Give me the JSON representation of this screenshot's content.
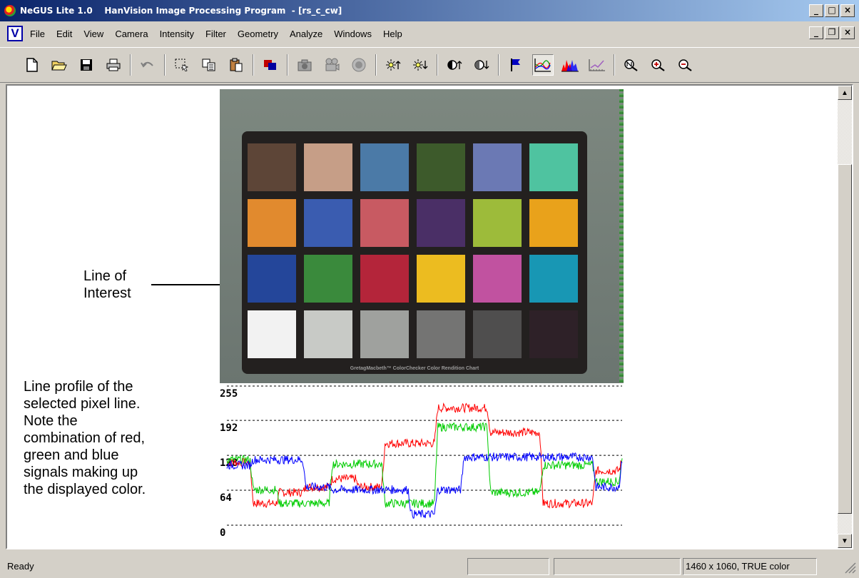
{
  "window": {
    "title": "NeGUS Lite 1.0    HanVision Image Processing Program  - [rs_c_cw]",
    "minimize_glyph": "_",
    "maximize_glyph": "□",
    "close_glyph": "×",
    "restore_glyph": "❐"
  },
  "menu": {
    "doc_icon_letter": "V",
    "items": [
      "File",
      "Edit",
      "View",
      "Camera",
      "Intensity",
      "Filter",
      "Geometry",
      "Analyze",
      "Windows",
      "Help"
    ]
  },
  "toolbar": {
    "buttons": [
      {
        "icon": "new-document-icon"
      },
      {
        "icon": "open-folder-icon"
      },
      {
        "icon": "save-disk-icon"
      },
      {
        "icon": "print-icon"
      },
      {
        "icon": "undo-icon"
      },
      {
        "icon": "select-region-icon"
      },
      {
        "icon": "copy-icon"
      },
      {
        "icon": "paste-icon"
      },
      {
        "icon": "camera-stack-icon"
      },
      {
        "icon": "camera-icon"
      },
      {
        "icon": "video-camera-icon"
      },
      {
        "icon": "stop-record-icon"
      },
      {
        "icon": "brightness-up-icon"
      },
      {
        "icon": "brightness-down-icon"
      },
      {
        "icon": "contrast-up-icon"
      },
      {
        "icon": "contrast-down-icon"
      },
      {
        "icon": "flag-icon"
      },
      {
        "icon": "line-profile-icon",
        "pressed": true
      },
      {
        "icon": "histogram-icon"
      },
      {
        "icon": "measure-icon"
      },
      {
        "icon": "zoom-normal-icon"
      },
      {
        "icon": "zoom-in-icon"
      },
      {
        "icon": "zoom-out-icon"
      }
    ]
  },
  "image": {
    "patch_colors": [
      [
        "#5d4537",
        "#c69e87",
        "#4b7aa7",
        "#3d5a2b",
        "#6b79b4",
        "#4fc3a0"
      ],
      [
        "#e18a2e",
        "#3a5cb0",
        "#c85a62",
        "#4a2f66",
        "#9dbb3a",
        "#e9a21b"
      ],
      [
        "#24469a",
        "#3a8a3c",
        "#b4253a",
        "#ecbc20",
        "#c152a0",
        "#1897b4"
      ],
      [
        "#f2f2f2",
        "#c8cac6",
        "#9fa19e",
        "#747473",
        "#4f4e4e",
        "#2e2128"
      ]
    ],
    "board_caption": "GretagMacbeth™ ColorChecker Color Rendition Chart"
  },
  "annotations": {
    "line_of_interest": [
      "Line of",
      "Interest"
    ],
    "profile_caption": [
      "Line profile of the",
      "selected pixel line.",
      "Note the",
      "combination of red,",
      "green and blue",
      "signals making up",
      "the displayed color."
    ]
  },
  "chart_data": {
    "type": "line",
    "yticks": [
      "255",
      "192",
      "128",
      "64",
      "0"
    ],
    "ylim": [
      0,
      255
    ],
    "grid": "dashed horizontal at tick values",
    "patches": 6,
    "series": [
      {
        "color": "#ff0000",
        "values": [
          115,
          40,
          60,
          70,
          85,
          70,
          150,
          150,
          215,
          215,
          170,
          170,
          40,
          40,
          100,
          120
        ]
      },
      {
        "color": "#00cc00",
        "values": [
          120,
          65,
          40,
          40,
          112,
          112,
          40,
          40,
          180,
          180,
          60,
          60,
          110,
          110,
          80,
          120
        ]
      },
      {
        "color": "#0000ff",
        "values": [
          110,
          120,
          120,
          70,
          65,
          65,
          65,
          20,
          65,
          125,
          125,
          125,
          125,
          125,
          70,
          120
        ]
      }
    ]
  },
  "status": {
    "ready": "Ready",
    "info": "1460 x 1060, TRUE color"
  }
}
